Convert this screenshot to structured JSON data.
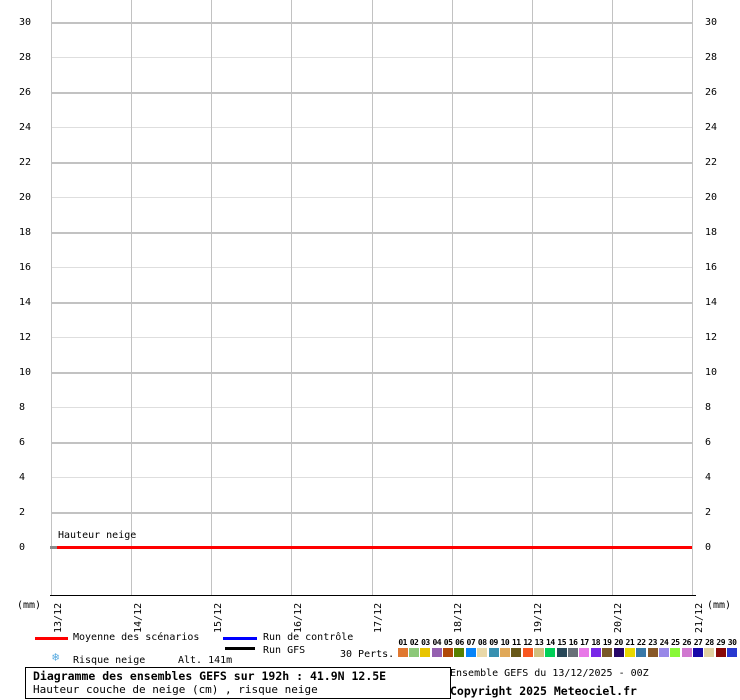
{
  "chart_data": {
    "type": "line",
    "title": "Diagramme des ensembles GEFS sur 192h : 41.9N 12.5E",
    "subtitle": "Hauteur couche de neige (cm) , risque neige",
    "unit": "(mm)",
    "ylim": [
      0,
      30
    ],
    "ytick_step": 2,
    "yticks": [
      0,
      2,
      4,
      6,
      8,
      10,
      12,
      14,
      16,
      18,
      20,
      22,
      24,
      26,
      28,
      30
    ],
    "grid": true,
    "x_dates": [
      "13/12",
      "14/12",
      "15/12",
      "16/12",
      "17/12",
      "18/12",
      "19/12",
      "20/12",
      "21/12"
    ],
    "annotation": "Hauteur neige",
    "series": [
      {
        "name": "Moyenne des scénarios",
        "color": "#ff0000",
        "values": [
          0,
          0,
          0,
          0,
          0,
          0,
          0,
          0,
          0
        ]
      },
      {
        "name": "Run de contrôle",
        "color": "#0000ff",
        "values": [
          0,
          0,
          0,
          0,
          0,
          0,
          0,
          0,
          0
        ]
      },
      {
        "name": "Run GFS",
        "color": "#000000",
        "values": [
          0,
          0,
          0,
          0,
          0,
          0,
          0,
          0,
          0
        ]
      }
    ]
  },
  "legend": {
    "mean_label": "Moyenne des scénarios",
    "mean_color": "#ff0000",
    "control_label": "Run de contrôle",
    "control_color": "#0000ff",
    "gfs_label": "Run GFS",
    "gfs_color": "#000000",
    "perts_label": "30 Perts.",
    "risk_label": "Risque neige",
    "alt_label": "Alt. 141m"
  },
  "icons": {
    "snowflake": "❄"
  },
  "perturbations": {
    "numbers": [
      "01",
      "02",
      "03",
      "04",
      "05",
      "06",
      "07",
      "08",
      "09",
      "10",
      "11",
      "12",
      "13",
      "14",
      "15",
      "16",
      "17",
      "18",
      "19",
      "20",
      "21",
      "22",
      "23",
      "24",
      "25",
      "26",
      "27",
      "28",
      "29",
      "30"
    ],
    "colors": [
      "#e07830",
      "#8cc878",
      "#e8c400",
      "#9560b0",
      "#b04808",
      "#588000",
      "#0884f8",
      "#e8d8a8",
      "#3890b0",
      "#e0a858",
      "#685818",
      "#f85820",
      "#d0c080",
      "#00d058",
      "#284858",
      "#687078",
      "#e878e8",
      "#7828e8",
      "#785828",
      "#280868",
      "#e8d800",
      "#3878a8",
      "#885828",
      "#9888e8",
      "#88f838",
      "#d078d0",
      "#1808a8",
      "#e0d0a0",
      "#880808",
      "#2838d0"
    ]
  },
  "footer": {
    "title_line1": "Diagramme des ensembles GEFS sur 192h : 41.9N 12.5E",
    "title_line2": "Hauteur couche de neige (cm) , risque neige",
    "run_info": "Ensemble GEFS du 13/12/2025 - 00Z",
    "copyright": "Copyright 2025 Meteociel.fr"
  }
}
